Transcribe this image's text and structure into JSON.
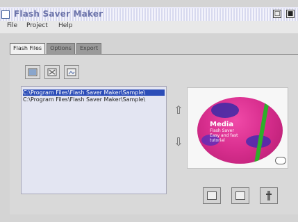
{
  "window": {
    "title": "Flash Saver Maker",
    "controls": [
      "□",
      "■"
    ]
  },
  "menu": [
    "File",
    "Project",
    "Help"
  ],
  "tabs": [
    {
      "label": "Flash Files",
      "active": true
    },
    {
      "label": "Options",
      "active": false
    },
    {
      "label": "Export",
      "active": false
    }
  ],
  "files": [
    {
      "path": "C:\\Program Files\\Flash Saver Maker\\Sample\\",
      "selected": true
    },
    {
      "path": "C:\\Program Files\\Flash Saver Maker\\Sample\\",
      "selected": false
    }
  ],
  "preview": {
    "brand": "Media",
    "text_lines": [
      "Flash Saver",
      "Easy and fast",
      "tutorial"
    ]
  },
  "icons": {
    "toolbar": [
      "add-file-icon",
      "remove-file-icon",
      "open-file-icon"
    ],
    "bottom": [
      "preview-icon",
      "save-icon",
      "build-icon"
    ]
  }
}
